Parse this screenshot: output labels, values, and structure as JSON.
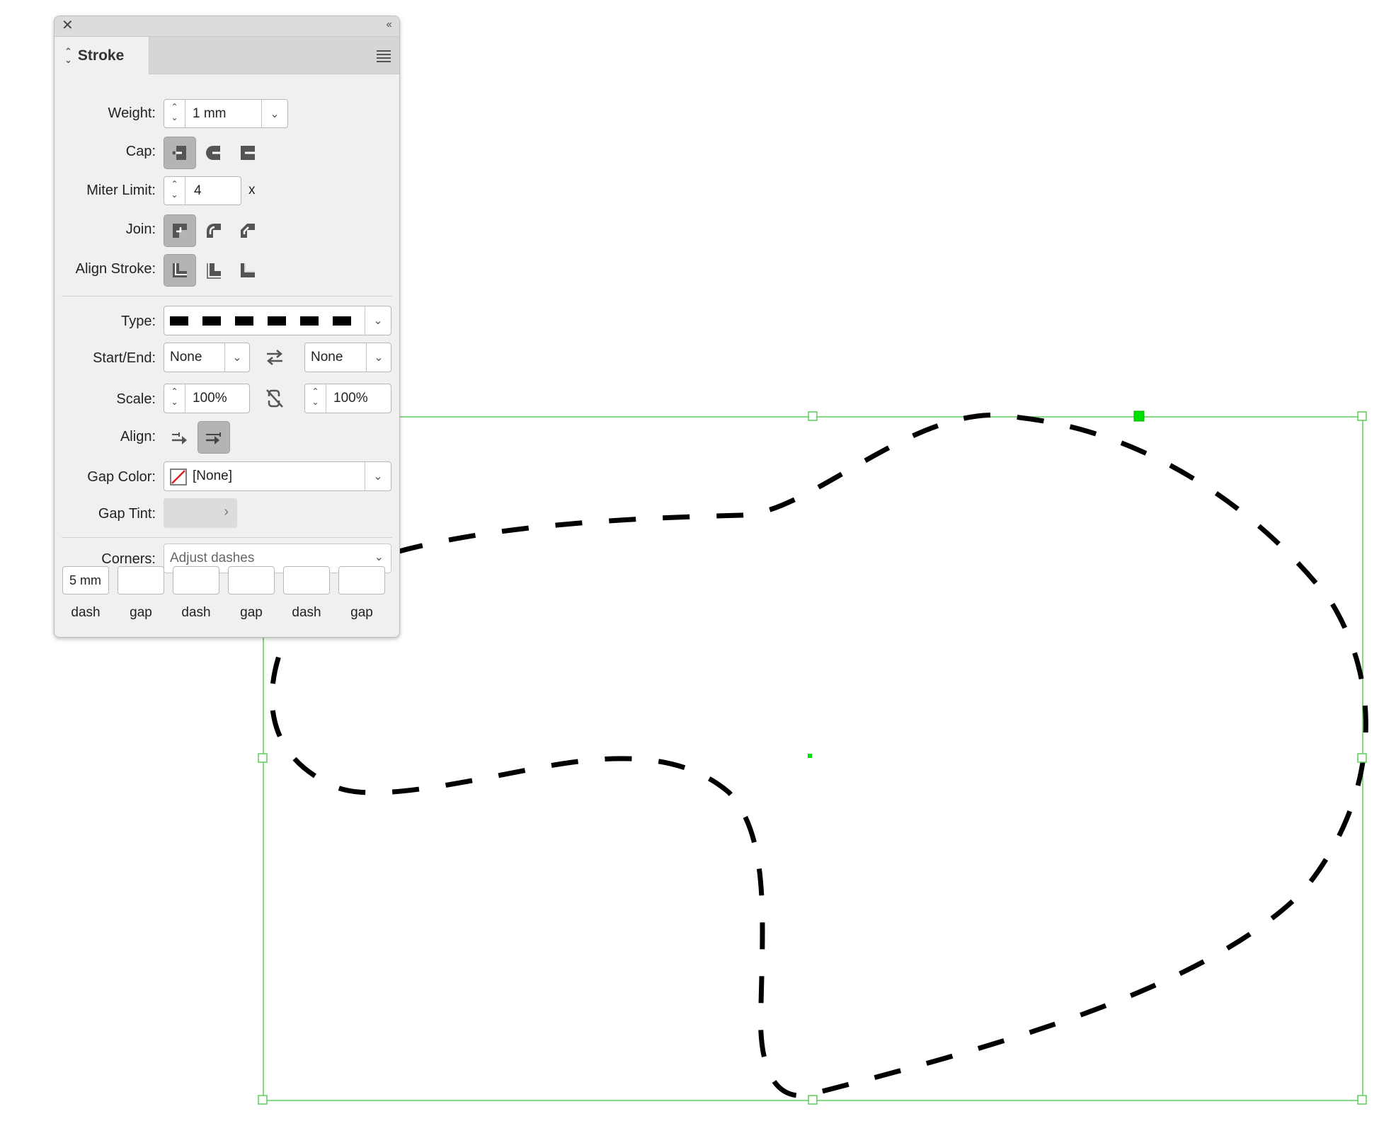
{
  "panel": {
    "tab_title": "Stroke",
    "collapse_label": "‹‹",
    "weight": {
      "label": "Weight:",
      "value": "1 mm"
    },
    "cap": {
      "label": "Cap:",
      "options": [
        "butt-cap",
        "round-cap",
        "projecting-cap"
      ],
      "selected": "butt-cap"
    },
    "miter": {
      "label": "Miter Limit:",
      "value": "4",
      "suffix": "x"
    },
    "join": {
      "label": "Join:",
      "options": [
        "miter-join",
        "round-join",
        "bevel-join"
      ],
      "selected": "miter-join"
    },
    "align_stroke": {
      "label": "Align Stroke:",
      "options": [
        "align-center",
        "align-inside",
        "align-outside"
      ],
      "selected": "align-center"
    },
    "type": {
      "label": "Type:",
      "value": "dashed"
    },
    "start_end": {
      "label": "Start/End:",
      "start": "None",
      "end": "None"
    },
    "scale": {
      "label": "Scale:",
      "start": "100%",
      "end": "100%"
    },
    "align": {
      "label": "Align:",
      "options": [
        "extend-arrowhead",
        "place-arrowhead"
      ],
      "selected": "place-arrowhead"
    },
    "gap_color": {
      "label": "Gap Color:",
      "value": "[None]"
    },
    "gap_tint": {
      "label": "Gap Tint:"
    },
    "corners": {
      "label": "Corners:",
      "value": "Adjust dashes"
    },
    "dashes": [
      {
        "value": "5 mm",
        "label": "dash"
      },
      {
        "value": "",
        "label": "gap"
      },
      {
        "value": "",
        "label": "dash"
      },
      {
        "value": "",
        "label": "gap"
      },
      {
        "value": "",
        "label": "dash"
      },
      {
        "value": "",
        "label": "gap"
      }
    ]
  },
  "colors": {
    "selection": "#5ccf5c",
    "selection_handle_fill": "#00e000",
    "stroke": "#000000",
    "panel_bg": "#f0f0f0"
  }
}
